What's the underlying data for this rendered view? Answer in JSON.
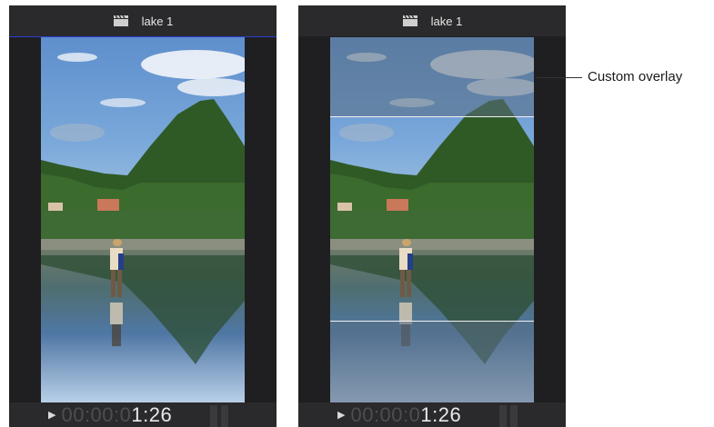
{
  "viewers": [
    {
      "title": "lake 1",
      "timecode_dim": "00:00:0",
      "timecode_bright": "1:26"
    },
    {
      "title": "lake 1",
      "timecode_dim": "00:00:0",
      "timecode_bright": "1:26"
    }
  ],
  "callout": {
    "label": "Custom overlay"
  },
  "icons": {
    "clip": "clapperboard-icon",
    "play": "play-icon"
  },
  "colors": {
    "panel": "#1f1f21",
    "titlebar": "#2a2a2c",
    "overlay_line": "#f2f2f2",
    "focus_line": "#2b3fd0"
  }
}
